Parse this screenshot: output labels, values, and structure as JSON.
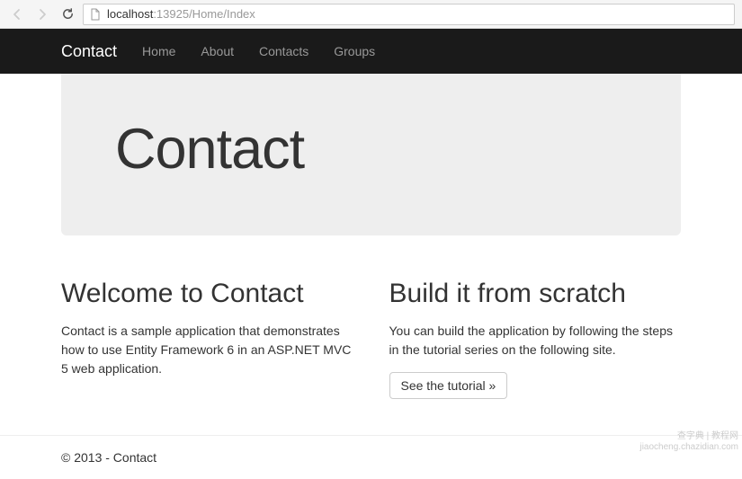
{
  "browser": {
    "url_host": "localhost",
    "url_port_path": ":13925/Home/Index"
  },
  "navbar": {
    "brand": "Contact",
    "links": [
      "Home",
      "About",
      "Contacts",
      "Groups"
    ]
  },
  "jumbotron": {
    "title": "Contact"
  },
  "columns": {
    "left": {
      "heading": "Welcome to Contact",
      "body": "Contact is a sample application that demonstrates how to use Entity Framework 6 in an ASP.NET MVC 5 web application."
    },
    "right": {
      "heading": "Build it from scratch",
      "body": "You can build the application by following the steps in the tutorial series on the following site.",
      "button": "See the tutorial »"
    }
  },
  "footer": {
    "text": "© 2013 - Contact"
  },
  "watermark": {
    "line1": "查字典 | 教程网",
    "line2": "jiaocheng.chazidian.com"
  }
}
